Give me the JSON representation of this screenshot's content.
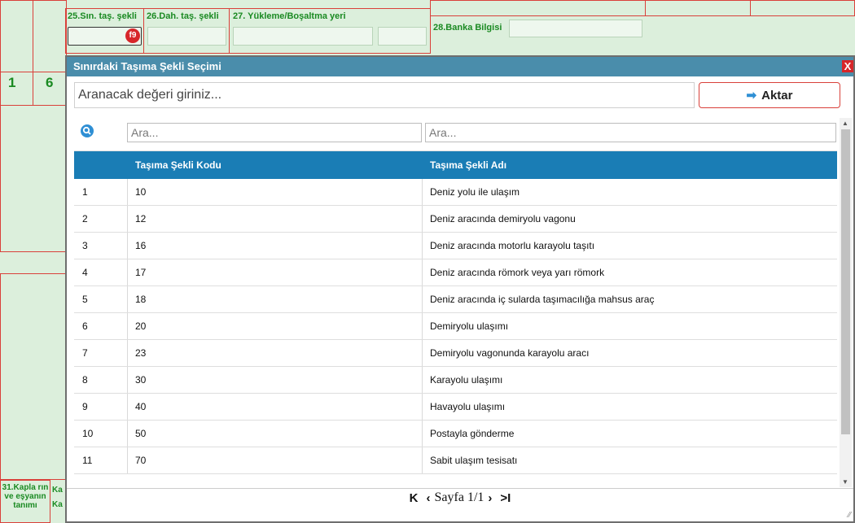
{
  "background_form": {
    "fields": [
      {
        "label": "25.Sın. taş. şekli"
      },
      {
        "label": "26.Dah. taş. şekli"
      },
      {
        "label": "27. Yükleme/Boşaltma yeri"
      },
      {
        "label": "28.Banka Bilgisi"
      }
    ],
    "box_numbers": [
      "1",
      "6"
    ],
    "f9_badge": "f9",
    "bottom_label": "31.Kapla rın ve eşyanın tanımı",
    "bottom_label_2": "Ka",
    "bottom_label_3": "Ka"
  },
  "dialog": {
    "title": "Sınırdaki Taşıma Şekli Seçimi",
    "close_label": "X",
    "search_placeholder": "Aranacak değeri giriniz...",
    "transfer_label": "Aktar",
    "filter_placeholder_1": "Ara...",
    "filter_placeholder_2": "Ara...",
    "columns": [
      "",
      "Taşıma Şekli Kodu",
      "Taşıma Şekli Adı"
    ],
    "rows": [
      {
        "no": "1",
        "code": "10",
        "name": "Deniz yolu ile ulaşım"
      },
      {
        "no": "2",
        "code": "12",
        "name": "Deniz aracında demiryolu vagonu"
      },
      {
        "no": "3",
        "code": "16",
        "name": "Deniz aracında motorlu karayolu taşıtı"
      },
      {
        "no": "4",
        "code": "17",
        "name": "Deniz aracında römork veya yarı römork"
      },
      {
        "no": "5",
        "code": "18",
        "name": "Deniz aracında iç sularda taşımacılığa mahsus araç"
      },
      {
        "no": "6",
        "code": "20",
        "name": "Demiryolu ulaşımı"
      },
      {
        "no": "7",
        "code": "23",
        "name": "Demiryolu vagonunda karayolu aracı"
      },
      {
        "no": "8",
        "code": "30",
        "name": "Karayolu ulaşımı"
      },
      {
        "no": "9",
        "code": "40",
        "name": "Havayolu ulaşımı"
      },
      {
        "no": "10",
        "code": "50",
        "name": "Postayla gönderme"
      },
      {
        "no": "11",
        "code": "70",
        "name": "Sabit ulaşım tesisatı"
      }
    ],
    "pager": {
      "label": "Sayfa 1/1"
    }
  },
  "colors": {
    "header_bg": "#1a7db5",
    "title_bg": "#4a8dab",
    "accent_red": "#d9403a",
    "form_green": "#1a8a22"
  }
}
